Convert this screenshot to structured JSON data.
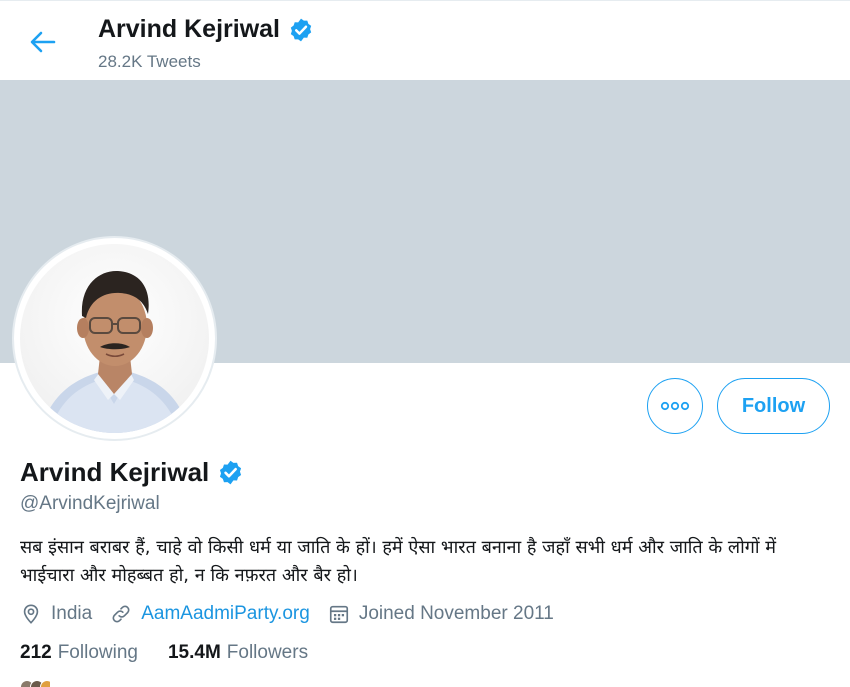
{
  "header": {
    "name": "Arvind Kejriwal",
    "tweet_count": "28.2K Tweets"
  },
  "profile": {
    "name": "Arvind Kejriwal",
    "handle": "@ArvindKejriwal",
    "bio": "सब इंसान बराबर हैं, चाहे वो किसी धर्म या जाति के हों। हमें ऐसा भारत बनाना है जहाँ सभी धर्म और जाति के लोगों में भाईचारा और मोहब्बत हो, न कि नफ़रत और बैर हो।",
    "location": "India",
    "website": "AamAadmiParty.org",
    "joined": "Joined November 2011"
  },
  "actions": {
    "follow_label": "Follow"
  },
  "stats": {
    "following_count": "212",
    "following_label": "Following",
    "followers_count": "15.4M",
    "followers_label": "Followers"
  },
  "colors": {
    "accent": "#1da1f2",
    "banner": "#ccd6dd",
    "secondary_text": "#657786",
    "verified": "#1da1f2"
  },
  "icons": [
    "back-arrow-icon",
    "verified-badge-icon",
    "more-dots-icon",
    "location-pin-icon",
    "link-icon",
    "calendar-icon"
  ]
}
